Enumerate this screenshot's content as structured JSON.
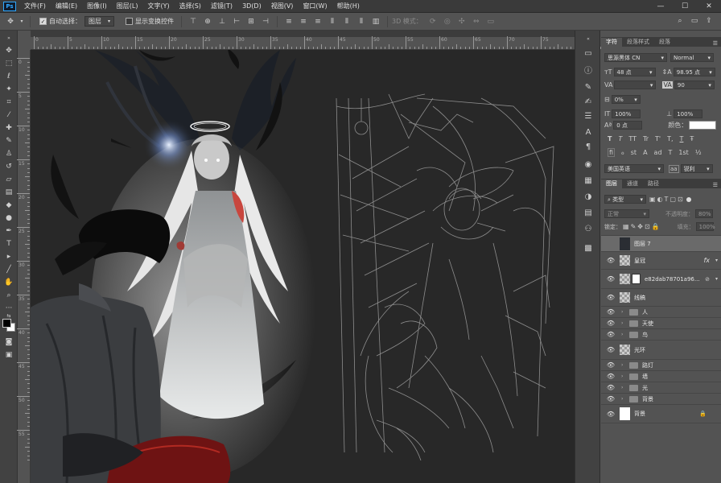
{
  "app": {
    "logo": "Ps"
  },
  "menu": [
    "文件(F)",
    "编辑(E)",
    "图像(I)",
    "图层(L)",
    "文字(Y)",
    "选择(S)",
    "滤镜(T)",
    "3D(D)",
    "视图(V)",
    "窗口(W)",
    "帮助(H)"
  ],
  "window_controls": [
    "—",
    "☐",
    "✕"
  ],
  "options": {
    "auto_select_label": "自动选择：",
    "auto_select_value": "图层",
    "show_transform_label": "显示变换控件",
    "mode_3d_label": "3D 模式："
  },
  "ruler": {
    "top_labels": [
      "0",
      "5",
      "10",
      "15",
      "20",
      "25",
      "30",
      "35",
      "40",
      "45",
      "50",
      "55",
      "60",
      "65",
      "70",
      "75",
      "80"
    ],
    "left_labels": [
      "0",
      "5",
      "10",
      "15",
      "20",
      "25",
      "30",
      "35",
      "40",
      "45",
      "50",
      "55"
    ]
  },
  "character": {
    "tabs": [
      "字符",
      "段落样式",
      "段落"
    ],
    "font_family": "思源黑体 CN",
    "font_style": "Normal",
    "font_size": "48 点",
    "leading": "98.95 点",
    "tracking_label": "VA",
    "tracking": "90",
    "kerning_label": "VA",
    "vscale": "0%",
    "hscale_v": "100%",
    "hscale_h": "100%",
    "baseline": "0 点",
    "color_label": "颜色：",
    "color": "#ffffff",
    "type_styles": [
      "T",
      "T",
      "TT",
      "Tr",
      "T'",
      "T,",
      "T",
      "Ŧ"
    ],
    "opentype": [
      "fi",
      "ℴ",
      "st",
      "A",
      "ad",
      "T",
      "1st",
      "½"
    ],
    "language": "美国英语",
    "antialias_icon": "aa",
    "antialias": "锐利"
  },
  "layers": {
    "tabs": [
      "图层",
      "通道",
      "路径"
    ],
    "filter_kind": "类型",
    "blend_mode": "正常",
    "opacity_label": "不透明度：",
    "opacity": "80%",
    "lock_label": "锁定：",
    "fill_label": "填充：",
    "fill": "100%",
    "items": [
      {
        "name": "图层 7",
        "type": "pixel",
        "selected": true,
        "visible": false
      },
      {
        "name": "皇冠",
        "type": "pixel",
        "fx": true,
        "visible": true
      },
      {
        "name": "e82dab78701a96...",
        "type": "smart",
        "visible": true
      },
      {
        "name": "线稿",
        "type": "pixel",
        "visible": true
      },
      {
        "name": "人",
        "type": "group",
        "visible": true
      },
      {
        "name": "天使",
        "type": "group",
        "visible": true
      },
      {
        "name": "鸟",
        "type": "group",
        "visible": true
      },
      {
        "name": "光环",
        "type": "pixel",
        "visible": true
      },
      {
        "name": "路灯",
        "type": "group",
        "visible": true
      },
      {
        "name": "墙",
        "type": "group",
        "visible": true
      },
      {
        "name": "光",
        "type": "group",
        "visible": true
      },
      {
        "name": "背景",
        "type": "group",
        "visible": true
      },
      {
        "name": "背景",
        "type": "background",
        "visible": true,
        "locked": true
      }
    ]
  }
}
